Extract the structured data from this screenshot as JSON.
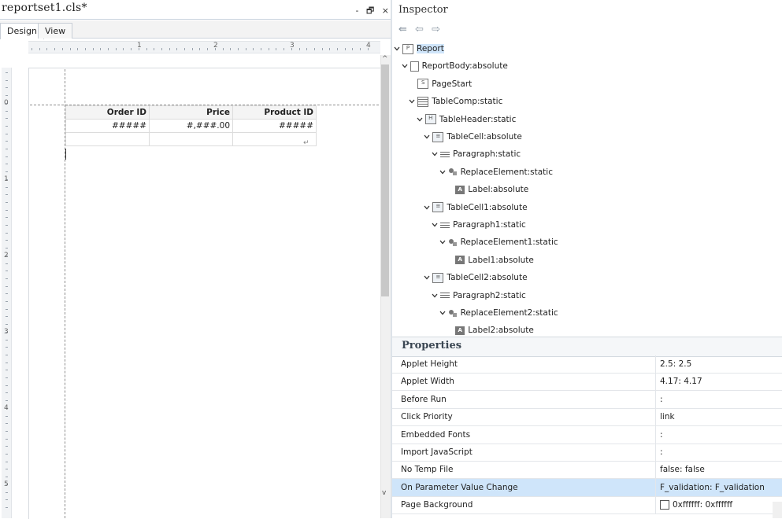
{
  "editor": {
    "title": "reportset1.cls*",
    "controls": [
      "-",
      "🗗",
      "×"
    ],
    "tabs": [
      {
        "label": "Design",
        "active": true
      },
      {
        "label": "View",
        "active": false
      }
    ],
    "ruler_numbers": [
      "1",
      "2",
      "3",
      "4"
    ],
    "vruler_numbers": [
      "0",
      "1",
      "2",
      "3",
      "4",
      "5"
    ],
    "table": {
      "headers": [
        "Order ID",
        "Price",
        "Product ID"
      ],
      "row1": [
        "#####",
        "#,###.00",
        "#####"
      ]
    },
    "return_mark": "↵",
    "scroll_up": "^",
    "scroll_down": "v"
  },
  "inspector": {
    "title": "Inspector",
    "nav": [
      "⇚",
      "⇦",
      "⇨"
    ],
    "tree": [
      {
        "label": "Report",
        "icon": "report-icon",
        "level": 0,
        "expanded": true,
        "selected": true
      },
      {
        "label": "ReportBody:absolute",
        "icon": "document-icon",
        "level": 1,
        "expanded": true
      },
      {
        "label": "PageStart",
        "icon": "pagestart-icon",
        "level": 2,
        "expanded": null
      },
      {
        "label": "TableComp:static",
        "icon": "table-icon",
        "level": 2,
        "expanded": true
      },
      {
        "label": "TableHeader:static",
        "icon": "table-header-icon",
        "level": 3,
        "expanded": true
      },
      {
        "label": "TableCell:absolute",
        "icon": "table-cell-icon",
        "level": 4,
        "expanded": true
      },
      {
        "label": "Paragraph:static",
        "icon": "paragraph-icon",
        "level": 5,
        "expanded": true
      },
      {
        "label": "ReplaceElement:static",
        "icon": "replace-element-icon",
        "level": 6,
        "expanded": true
      },
      {
        "label": "Label:absolute",
        "icon": "label-icon",
        "level": 7,
        "expanded": null
      },
      {
        "label": "TableCell1:absolute",
        "icon": "table-cell-icon",
        "level": 4,
        "expanded": true
      },
      {
        "label": "Paragraph1:static",
        "icon": "paragraph-icon",
        "level": 5,
        "expanded": true
      },
      {
        "label": "ReplaceElement1:static",
        "icon": "replace-element-icon",
        "level": 6,
        "expanded": true
      },
      {
        "label": "Label1:absolute",
        "icon": "label-icon",
        "level": 7,
        "expanded": null
      },
      {
        "label": "TableCell2:absolute",
        "icon": "table-cell-icon",
        "level": 4,
        "expanded": true
      },
      {
        "label": "Paragraph2:static",
        "icon": "paragraph-icon",
        "level": 5,
        "expanded": true
      },
      {
        "label": "ReplaceElement2:static",
        "icon": "replace-element-icon",
        "level": 6,
        "expanded": true
      },
      {
        "label": "Label2:absolute",
        "icon": "label-icon",
        "level": 7,
        "expanded": null
      }
    ],
    "properties_title": "Properties",
    "properties": [
      {
        "name": "Applet Height",
        "value": "2.5: 2.5"
      },
      {
        "name": "Applet Width",
        "value": "4.17: 4.17"
      },
      {
        "name": "Before Run",
        "value": ":"
      },
      {
        "name": "Click Priority",
        "value": "link"
      },
      {
        "name": "Embedded Fonts",
        "value": ":"
      },
      {
        "name": "Import JavaScript",
        "value": ":"
      },
      {
        "name": "No Temp File",
        "value": "false: false"
      },
      {
        "name": "On Parameter Value Change",
        "value": "F_validation: F_validation",
        "selected": true
      },
      {
        "name": "Page Background",
        "value": "0xffffff: 0xffffff",
        "swatch": "#ffffff"
      }
    ]
  }
}
